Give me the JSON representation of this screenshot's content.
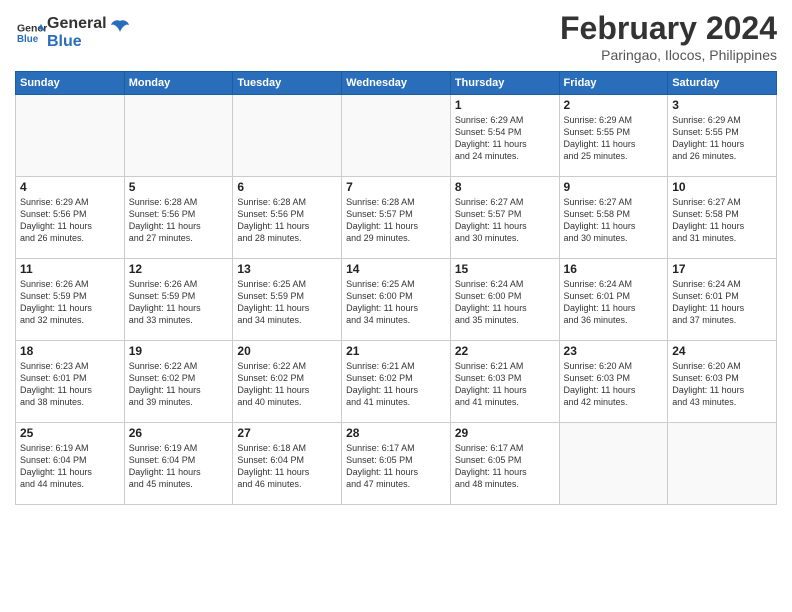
{
  "header": {
    "logo_line1": "General",
    "logo_line2": "Blue",
    "month_year": "February 2024",
    "location": "Paringao, Ilocos, Philippines"
  },
  "days_of_week": [
    "Sunday",
    "Monday",
    "Tuesday",
    "Wednesday",
    "Thursday",
    "Friday",
    "Saturday"
  ],
  "weeks": [
    [
      {
        "day": "",
        "info": ""
      },
      {
        "day": "",
        "info": ""
      },
      {
        "day": "",
        "info": ""
      },
      {
        "day": "",
        "info": ""
      },
      {
        "day": "1",
        "info": "Sunrise: 6:29 AM\nSunset: 5:54 PM\nDaylight: 11 hours\nand 24 minutes."
      },
      {
        "day": "2",
        "info": "Sunrise: 6:29 AM\nSunset: 5:55 PM\nDaylight: 11 hours\nand 25 minutes."
      },
      {
        "day": "3",
        "info": "Sunrise: 6:29 AM\nSunset: 5:55 PM\nDaylight: 11 hours\nand 26 minutes."
      }
    ],
    [
      {
        "day": "4",
        "info": "Sunrise: 6:29 AM\nSunset: 5:56 PM\nDaylight: 11 hours\nand 26 minutes."
      },
      {
        "day": "5",
        "info": "Sunrise: 6:28 AM\nSunset: 5:56 PM\nDaylight: 11 hours\nand 27 minutes."
      },
      {
        "day": "6",
        "info": "Sunrise: 6:28 AM\nSunset: 5:56 PM\nDaylight: 11 hours\nand 28 minutes."
      },
      {
        "day": "7",
        "info": "Sunrise: 6:28 AM\nSunset: 5:57 PM\nDaylight: 11 hours\nand 29 minutes."
      },
      {
        "day": "8",
        "info": "Sunrise: 6:27 AM\nSunset: 5:57 PM\nDaylight: 11 hours\nand 30 minutes."
      },
      {
        "day": "9",
        "info": "Sunrise: 6:27 AM\nSunset: 5:58 PM\nDaylight: 11 hours\nand 30 minutes."
      },
      {
        "day": "10",
        "info": "Sunrise: 6:27 AM\nSunset: 5:58 PM\nDaylight: 11 hours\nand 31 minutes."
      }
    ],
    [
      {
        "day": "11",
        "info": "Sunrise: 6:26 AM\nSunset: 5:59 PM\nDaylight: 11 hours\nand 32 minutes."
      },
      {
        "day": "12",
        "info": "Sunrise: 6:26 AM\nSunset: 5:59 PM\nDaylight: 11 hours\nand 33 minutes."
      },
      {
        "day": "13",
        "info": "Sunrise: 6:25 AM\nSunset: 5:59 PM\nDaylight: 11 hours\nand 34 minutes."
      },
      {
        "day": "14",
        "info": "Sunrise: 6:25 AM\nSunset: 6:00 PM\nDaylight: 11 hours\nand 34 minutes."
      },
      {
        "day": "15",
        "info": "Sunrise: 6:24 AM\nSunset: 6:00 PM\nDaylight: 11 hours\nand 35 minutes."
      },
      {
        "day": "16",
        "info": "Sunrise: 6:24 AM\nSunset: 6:01 PM\nDaylight: 11 hours\nand 36 minutes."
      },
      {
        "day": "17",
        "info": "Sunrise: 6:24 AM\nSunset: 6:01 PM\nDaylight: 11 hours\nand 37 minutes."
      }
    ],
    [
      {
        "day": "18",
        "info": "Sunrise: 6:23 AM\nSunset: 6:01 PM\nDaylight: 11 hours\nand 38 minutes."
      },
      {
        "day": "19",
        "info": "Sunrise: 6:22 AM\nSunset: 6:02 PM\nDaylight: 11 hours\nand 39 minutes."
      },
      {
        "day": "20",
        "info": "Sunrise: 6:22 AM\nSunset: 6:02 PM\nDaylight: 11 hours\nand 40 minutes."
      },
      {
        "day": "21",
        "info": "Sunrise: 6:21 AM\nSunset: 6:02 PM\nDaylight: 11 hours\nand 41 minutes."
      },
      {
        "day": "22",
        "info": "Sunrise: 6:21 AM\nSunset: 6:03 PM\nDaylight: 11 hours\nand 41 minutes."
      },
      {
        "day": "23",
        "info": "Sunrise: 6:20 AM\nSunset: 6:03 PM\nDaylight: 11 hours\nand 42 minutes."
      },
      {
        "day": "24",
        "info": "Sunrise: 6:20 AM\nSunset: 6:03 PM\nDaylight: 11 hours\nand 43 minutes."
      }
    ],
    [
      {
        "day": "25",
        "info": "Sunrise: 6:19 AM\nSunset: 6:04 PM\nDaylight: 11 hours\nand 44 minutes."
      },
      {
        "day": "26",
        "info": "Sunrise: 6:19 AM\nSunset: 6:04 PM\nDaylight: 11 hours\nand 45 minutes."
      },
      {
        "day": "27",
        "info": "Sunrise: 6:18 AM\nSunset: 6:04 PM\nDaylight: 11 hours\nand 46 minutes."
      },
      {
        "day": "28",
        "info": "Sunrise: 6:17 AM\nSunset: 6:05 PM\nDaylight: 11 hours\nand 47 minutes."
      },
      {
        "day": "29",
        "info": "Sunrise: 6:17 AM\nSunset: 6:05 PM\nDaylight: 11 hours\nand 48 minutes."
      },
      {
        "day": "",
        "info": ""
      },
      {
        "day": "",
        "info": ""
      }
    ]
  ]
}
